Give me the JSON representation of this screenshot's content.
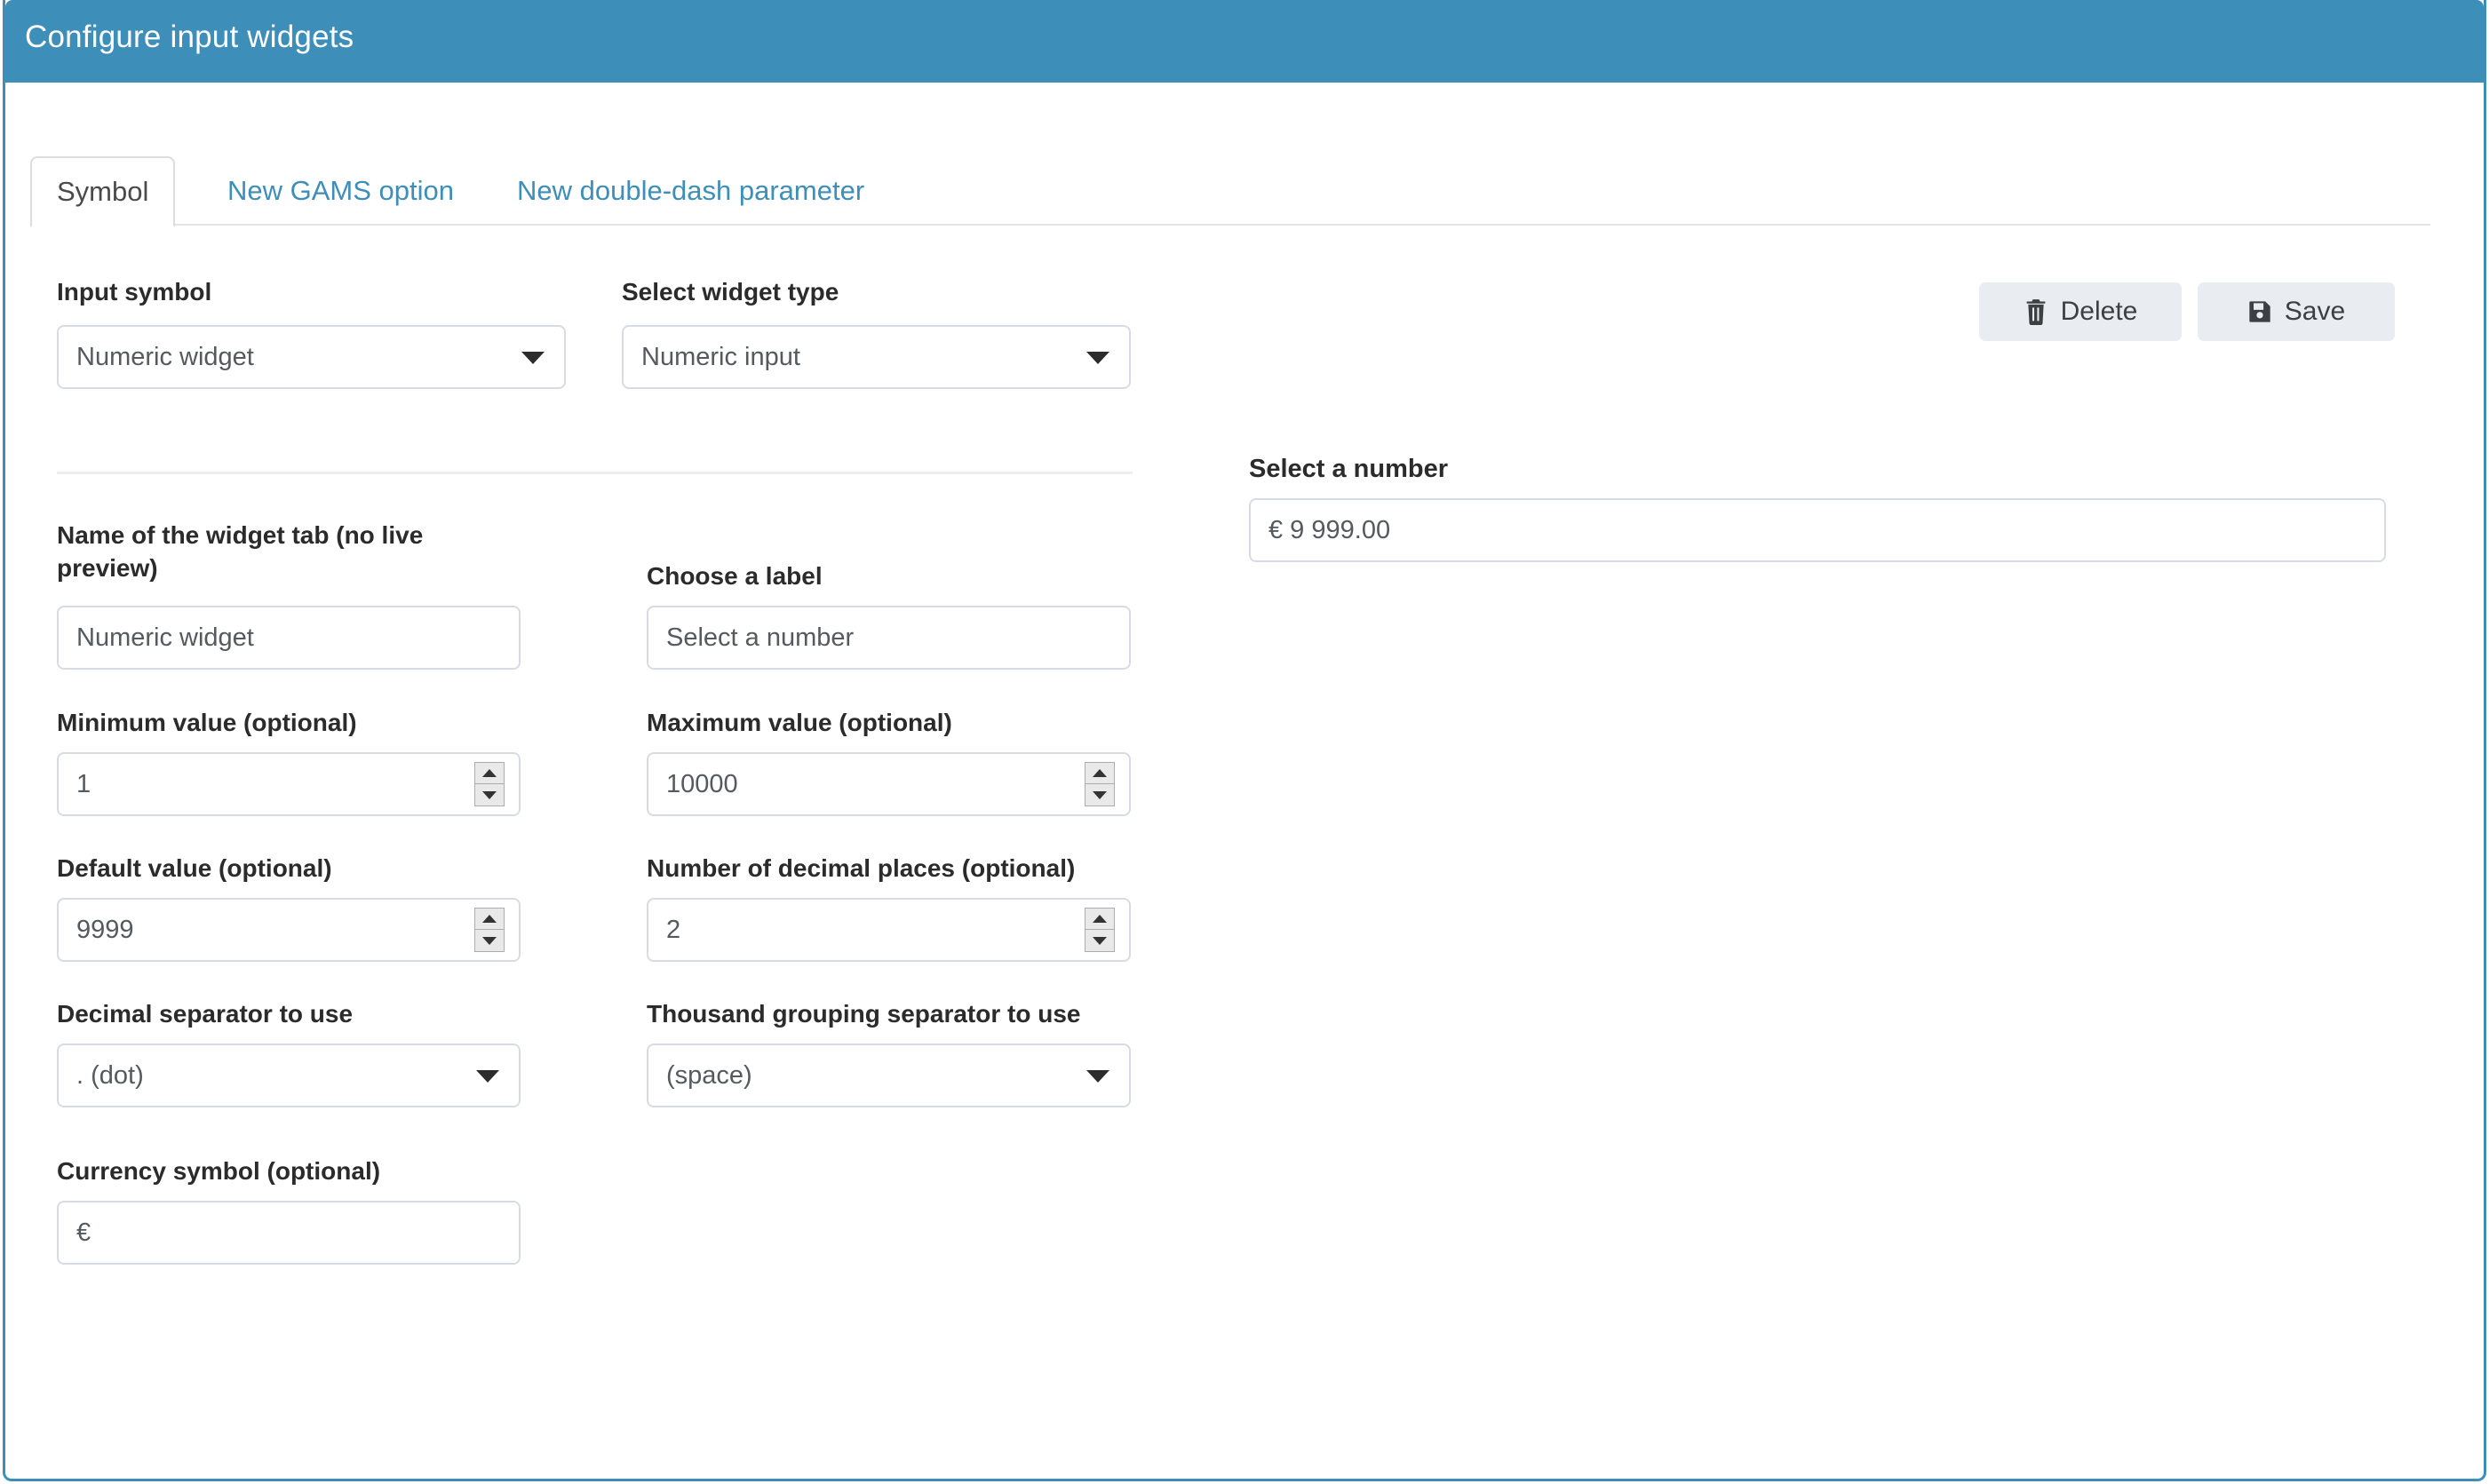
{
  "window": {
    "title": "Configure input widgets",
    "header_color": "#3d8eb9",
    "border_color": "#3d8eb9"
  },
  "tabs": [
    {
      "label": "Symbol",
      "active": true
    },
    {
      "label": "New GAMS option",
      "active": false
    },
    {
      "label": "New double-dash parameter",
      "active": false
    }
  ],
  "toolbar": {
    "delete_label": "Delete",
    "save_label": "Save"
  },
  "top_row": {
    "input_symbol": {
      "label": "Input symbol",
      "value": "Numeric widget"
    },
    "widget_type": {
      "label": "Select widget type",
      "value": "Numeric input"
    }
  },
  "form": {
    "widget_tab_name": {
      "label": "Name of the widget tab (no live preview)",
      "value": "Numeric widget"
    },
    "choose_label": {
      "label": "Choose a label",
      "value": "Select a number"
    },
    "minimum_value": {
      "label": "Minimum value (optional)",
      "value": "1"
    },
    "maximum_value": {
      "label": "Maximum value (optional)",
      "value": "10000"
    },
    "default_value": {
      "label": "Default value (optional)",
      "value": "9999"
    },
    "decimal_places": {
      "label": "Number of decimal places (optional)",
      "value": "2"
    },
    "decimal_separator": {
      "label": "Decimal separator to use",
      "value": ". (dot)"
    },
    "thousand_separator": {
      "label": "Thousand grouping separator to use",
      "value": "(space)"
    },
    "currency_symbol": {
      "label": "Currency symbol (optional)",
      "value": "€"
    }
  },
  "preview": {
    "label": "Select a number",
    "value": "€ 9 999.00"
  }
}
